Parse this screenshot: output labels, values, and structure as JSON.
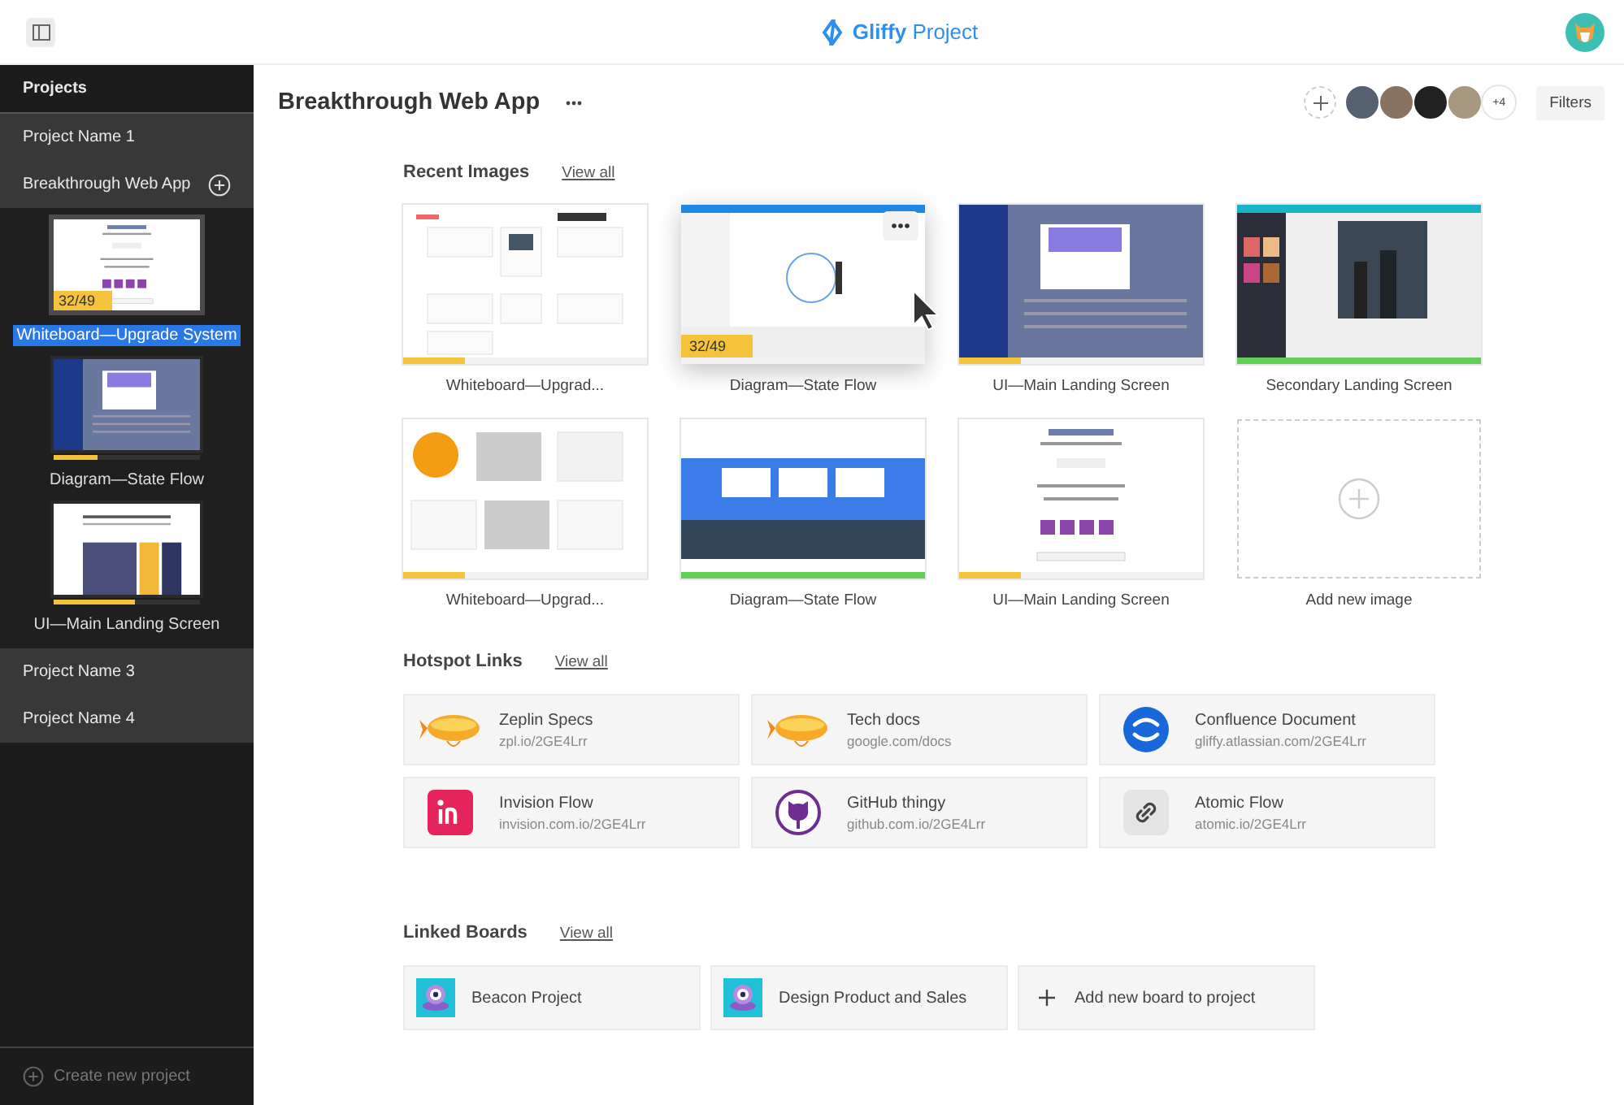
{
  "header": {
    "logo_bold": "Gliffy",
    "logo_rest": "Project"
  },
  "sidebar": {
    "title": "Projects",
    "items": [
      {
        "label": "Project Name 1",
        "expanded": false
      },
      {
        "label": "Breakthrough Web App",
        "expanded": true,
        "children": [
          {
            "label": "Whiteboard—Upgrade System",
            "selected": true,
            "kind": "thank-you",
            "badge": "32/49"
          },
          {
            "label": "Diagram—State Flow",
            "selected": false,
            "kind": "dashboard",
            "level": 0.3
          },
          {
            "label": "UI—Main Landing Screen",
            "selected": false,
            "kind": "landing",
            "level": 0.55
          }
        ]
      },
      {
        "label": "Project Name 3",
        "expanded": false
      },
      {
        "label": "Project Name 4",
        "expanded": false
      }
    ],
    "create": "Create new project"
  },
  "main": {
    "title": "Breakthrough Web App",
    "more_count": "+4",
    "filters": "Filters",
    "recent_images": {
      "title": "Recent Images",
      "view_all": "View all",
      "items": [
        {
          "kind": "whiteboard",
          "label": "Whiteboard—Upgrad...",
          "level": 0.25,
          "hovered": false
        },
        {
          "kind": "diagram",
          "label": "Diagram—State Flow",
          "badge": "32/49",
          "hovered": true
        },
        {
          "kind": "dashboard",
          "label": "UI—Main Landing Screen",
          "level": 0.25,
          "hovered": false
        },
        {
          "kind": "photo",
          "label": "Secondary Landing Screen",
          "level": 1,
          "hovered": false
        },
        {
          "kind": "boards",
          "label": "Whiteboard—Upgrad...",
          "level": 0.25,
          "hovered": false
        },
        {
          "kind": "banner",
          "label": "Diagram—State Flow",
          "level": 1,
          "hovered": false
        },
        {
          "kind": "thank-you",
          "label": "UI—Main Landing Screen",
          "level": 0.25,
          "hovered": false
        },
        {
          "kind": "add",
          "label": "Add new image"
        }
      ]
    },
    "hotspot_links": {
      "title": "Hotspot Links",
      "view_all": "View all",
      "items": [
        {
          "kind": "zeppelin",
          "name": "Zeplin Specs",
          "url": "zpl.io/2GE4Lrr"
        },
        {
          "kind": "zeppelin",
          "name": "Tech docs",
          "url": "google.com/docs"
        },
        {
          "kind": "confluence",
          "name": "Confluence Document",
          "url": "gliffy.atlassian.com/2GE4Lrr"
        },
        {
          "kind": "invision",
          "name": "Invision Flow",
          "url": "invision.com.io/2GE4Lrr"
        },
        {
          "kind": "github",
          "name": "GitHub thingy",
          "url": "github.com.io/2GE4Lrr"
        },
        {
          "kind": "link",
          "name": "Atomic Flow",
          "url": "atomic.io/2GE4Lrr"
        }
      ]
    },
    "linked_boards": {
      "title": "Linked Boards",
      "view_all": "View all",
      "items": [
        {
          "kind": "board",
          "label": "Beacon Project"
        },
        {
          "kind": "board",
          "label": "Design Product and Sales"
        },
        {
          "kind": "add",
          "label": "Add new board to project"
        }
      ]
    }
  }
}
